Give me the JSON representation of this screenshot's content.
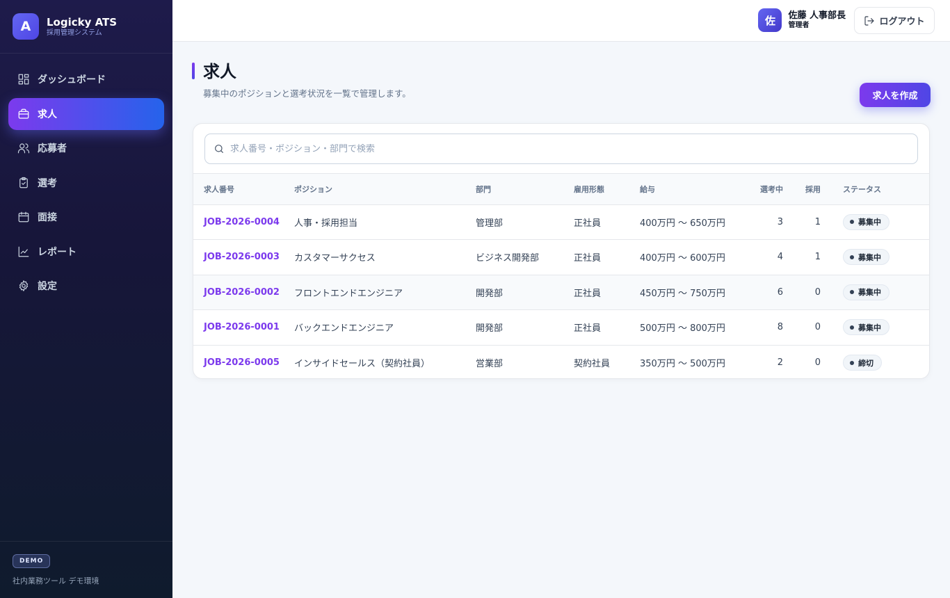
{
  "brand": {
    "logo": "A",
    "title": "Logicky ATS",
    "subtitle": "採用管理システム"
  },
  "nav": [
    {
      "label": "ダッシュボード",
      "icon": "dashboard-icon",
      "active": false
    },
    {
      "label": "求人",
      "icon": "briefcase-icon",
      "active": true
    },
    {
      "label": "応募者",
      "icon": "users-icon",
      "active": false
    },
    {
      "label": "選考",
      "icon": "clipboard-icon",
      "active": false
    },
    {
      "label": "面接",
      "icon": "calendar-icon",
      "active": false
    },
    {
      "label": "レポート",
      "icon": "chart-icon",
      "active": false
    },
    {
      "label": "設定",
      "icon": "gear-icon",
      "active": false
    }
  ],
  "footer": {
    "badge": "DEMO",
    "note": "社内業務ツール デモ環境"
  },
  "header": {
    "avatar": "佐",
    "user_name": "佐藤 人事部長",
    "user_role": "管理者",
    "logout_label": "ログアウト"
  },
  "page": {
    "title": "求人",
    "subtitle": "募集中のポジションと選考状況を一覧で管理します。",
    "create_label": "求人を作成"
  },
  "search": {
    "placeholder": "求人番号・ポジション・部門で検索",
    "value": ""
  },
  "table": {
    "headers": [
      "求人番号",
      "ポジション",
      "部門",
      "雇用形態",
      "給与",
      "選考中",
      "採用",
      "ステータス"
    ],
    "rows": [
      {
        "id": "JOB-2026-0004",
        "position": "人事・採用担当",
        "dept": "管理部",
        "type": "正社員",
        "salary": "400万円 〜 650万円",
        "in_process": "3",
        "hired": "1",
        "status": "募集中"
      },
      {
        "id": "JOB-2026-0003",
        "position": "カスタマーサクセス",
        "dept": "ビジネス開発部",
        "type": "正社員",
        "salary": "400万円 〜 600万円",
        "in_process": "4",
        "hired": "1",
        "status": "募集中"
      },
      {
        "id": "JOB-2026-0002",
        "position": "フロントエンドエンジニア",
        "dept": "開発部",
        "type": "正社員",
        "salary": "450万円 〜 750万円",
        "in_process": "6",
        "hired": "0",
        "status": "募集中"
      },
      {
        "id": "JOB-2026-0001",
        "position": "バックエンドエンジニア",
        "dept": "開発部",
        "type": "正社員",
        "salary": "500万円 〜 800万円",
        "in_process": "8",
        "hired": "0",
        "status": "募集中"
      },
      {
        "id": "JOB-2026-0005",
        "position": "インサイドセールス（契約社員）",
        "dept": "営業部",
        "type": "契約社員",
        "salary": "350万円 〜 500万円",
        "in_process": "2",
        "hired": "0",
        "status": "締切"
      }
    ]
  },
  "colors": {
    "accent": "#7c3aed",
    "accent2": "#2563eb",
    "sidebar_bg": "#1e1b4b",
    "page_bg": "#f4f7fb"
  }
}
